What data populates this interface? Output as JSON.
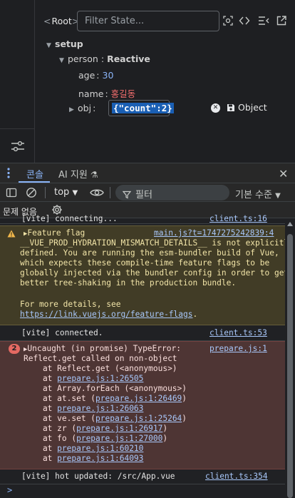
{
  "vue_panel": {
    "breadcrumb": "Root",
    "filter_placeholder": "Filter State...",
    "section": "setup",
    "rows": [
      {
        "key": "person",
        "sep": ":",
        "value": "Reactive"
      },
      {
        "key": "age",
        "sep": ":",
        "value": "30"
      },
      {
        "key": "name",
        "sep": ":",
        "value": "홍길동"
      },
      {
        "key": "obj",
        "sep": ":"
      }
    ],
    "edit_value": "{\"count\":2}",
    "save_label": "Object",
    "colors": {
      "number": "#8ab4f8",
      "string": "#ef6c6c",
      "selection": "#1a5fb4"
    }
  },
  "drawer": {
    "tabs": [
      {
        "label": "콘솔",
        "active": true
      },
      {
        "label": "AI 지원",
        "icon": "flask-icon",
        "active": false
      }
    ],
    "context": "top",
    "filter_placeholder": "필터",
    "levels": "기본 수준",
    "issues_label": "문제 없음"
  },
  "console": {
    "partial": {
      "text": "[vite] connecting...",
      "source": "client.ts:16"
    },
    "warning": {
      "source": "main.js?t=1747275242839:4",
      "lines": [
        "Feature flag",
        "__VUE_PROD_HYDRATION_MISMATCH_DETAILS__ is not explicitly",
        "defined. You are running the esm-bundler build of Vue,",
        "which expects these compile-time feature flags to be",
        "globally injected via the bundler config in order to get",
        "better tree-shaking in the production bundle.",
        "",
        "For more details, see"
      ],
      "link": "https://link.vuejs.org/feature-flags",
      "link_suffix": "."
    },
    "connected": {
      "text": "[vite] connected.",
      "source": "client.ts:53"
    },
    "error": {
      "count": "2",
      "source": "prepare.js:1",
      "head": "Uncaught (in promise) TypeError:",
      "message": "Reflect.get called on non-object",
      "stack": [
        {
          "prefix": "    at Reflect.get (<anonymous>)",
          "link": "",
          "suffix": ""
        },
        {
          "prefix": "    at ",
          "link": "prepare.js:1:26505",
          "suffix": ""
        },
        {
          "prefix": "    at Array.forEach (<anonymous>)",
          "link": "",
          "suffix": ""
        },
        {
          "prefix": "    at at.set (",
          "link": "prepare.js:1:26469",
          "suffix": ")"
        },
        {
          "prefix": "    at ",
          "link": "prepare.js:1:26063",
          "suffix": ""
        },
        {
          "prefix": "    at ve.set (",
          "link": "prepare.js:1:25264",
          "suffix": ")"
        },
        {
          "prefix": "    at zr (",
          "link": "prepare.js:1:26917",
          "suffix": ")"
        },
        {
          "prefix": "    at fo (",
          "link": "prepare.js:1:27000",
          "suffix": ")"
        },
        {
          "prefix": "    at ",
          "link": "prepare.js:1:60210",
          "suffix": ""
        },
        {
          "prefix": "    at ",
          "link": "prepare.js:1:64093",
          "suffix": ""
        }
      ]
    },
    "hot_update": {
      "text": "[vite] hot updated: /src/App.vue",
      "source": "client.ts:354"
    },
    "prompt": ">"
  }
}
